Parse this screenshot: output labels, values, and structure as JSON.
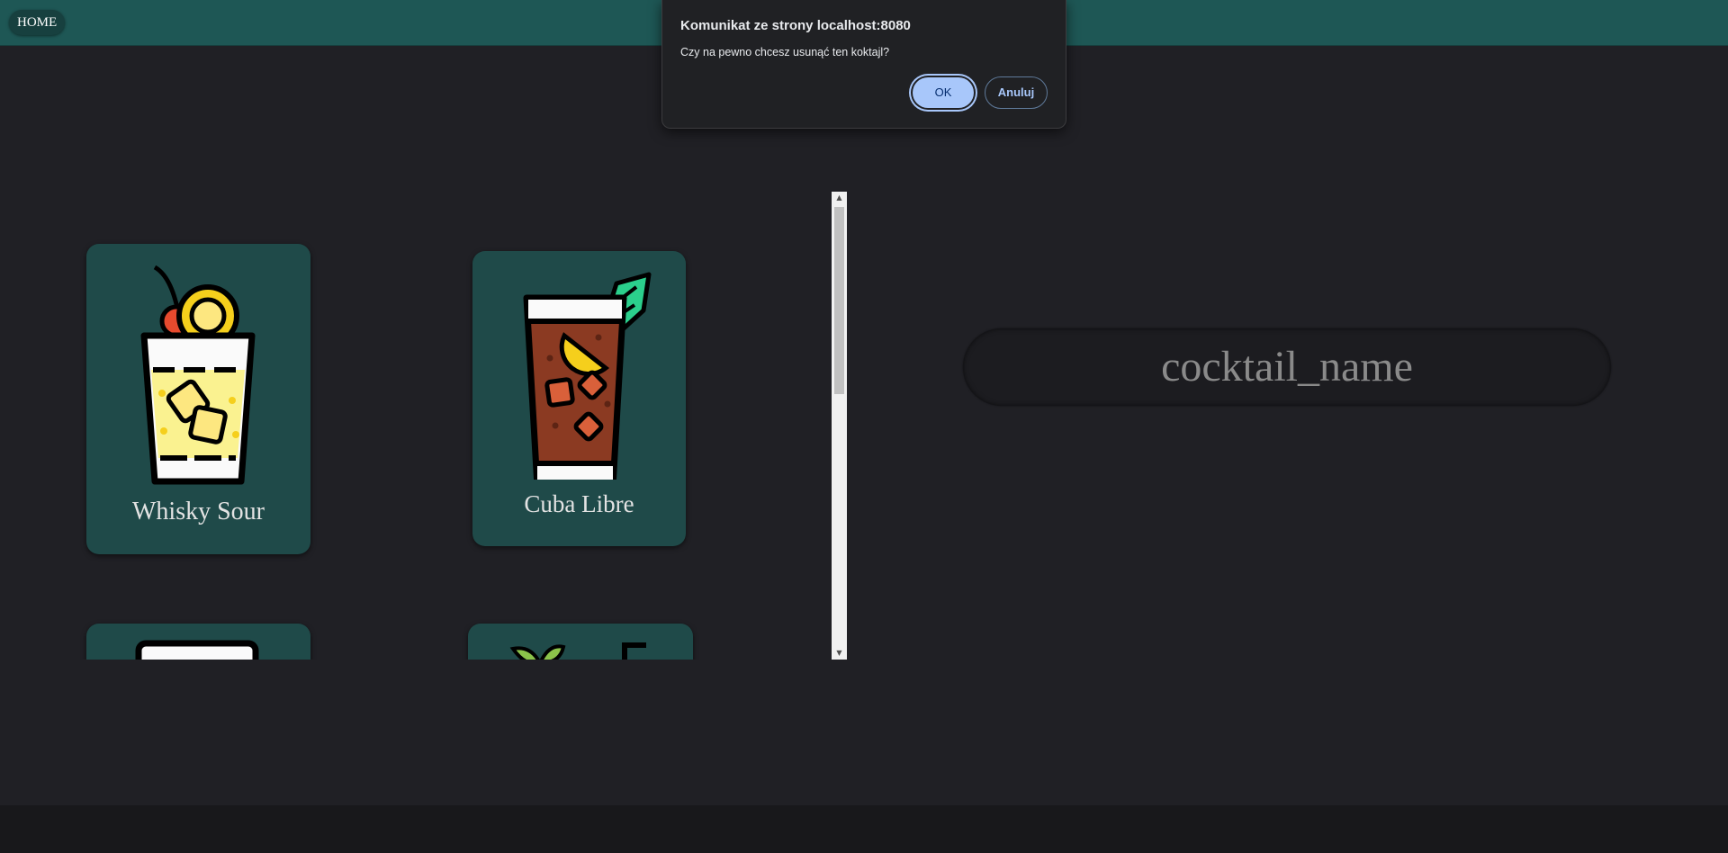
{
  "nav": {
    "home_label": "HOME"
  },
  "cocktails": [
    {
      "name": "Whisky Sour",
      "icon": "whisky-sour-glass-icon"
    },
    {
      "name": "Cuba Libre",
      "icon": "cuba-libre-glass-icon"
    },
    {
      "name": "",
      "icon": "tall-glass-icon"
    },
    {
      "name": "",
      "icon": "mojito-glass-icon"
    }
  ],
  "detail": {
    "name_placeholder": "cocktail_name"
  },
  "dialog": {
    "title": "Komunikat ze strony localhost:8080",
    "message": "Czy na pewno chcesz usunąć ten koktajl?",
    "ok_label": "OK",
    "cancel_label": "Anuluj"
  },
  "colors": {
    "topbar": "#1e5755",
    "card": "#1f4a49",
    "background": "#202025",
    "dialog_ok": "#a8c7fa"
  }
}
